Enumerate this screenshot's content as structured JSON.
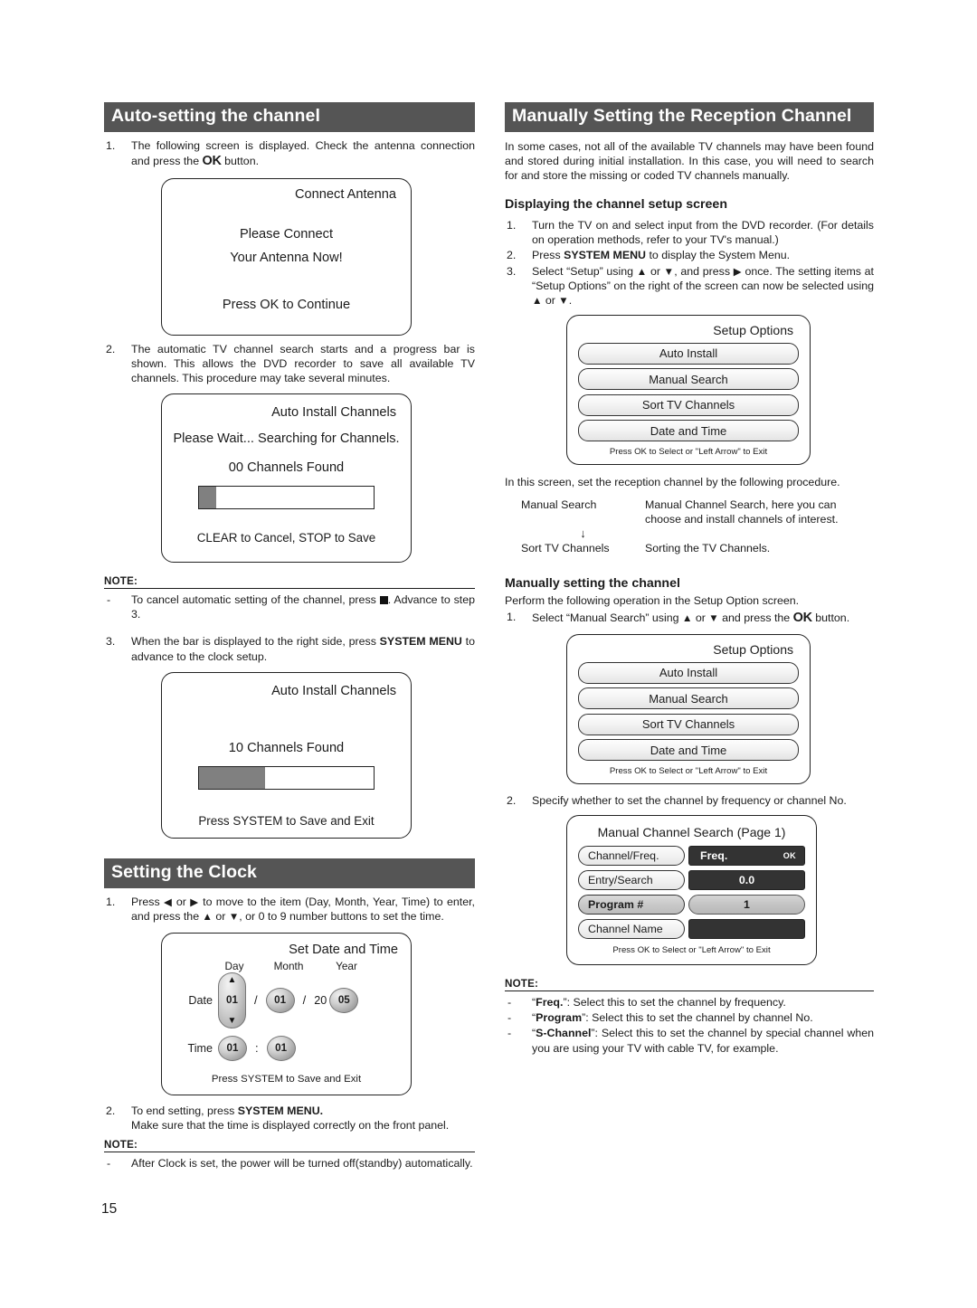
{
  "page_number": "15",
  "left_column": {
    "section1": {
      "header": "Auto-setting the channel",
      "step1": {
        "num": "1.",
        "text_a": "The following screen is displayed. Check the antenna connection and press the ",
        "ok": "OK",
        "text_b": " button."
      },
      "antenna_screen": {
        "title": "Connect Antenna",
        "line1": "Please Connect",
        "line2": "Your Antenna Now!",
        "line3": "Press OK to Continue"
      },
      "step2": {
        "num": "2.",
        "text": "The automatic TV channel search starts and a progress bar is shown. This allows the DVD recorder to save all available TV channels. This procedure may take several minutes."
      },
      "install_screen_1": {
        "title": "Auto Install Channels",
        "line1": "Please Wait... Searching for Channels.",
        "count": "00  Channels Found",
        "progress_percent": 10,
        "footer": "CLEAR to Cancel, STOP to Save"
      },
      "note": {
        "label": "NOTE:",
        "items": [
          {
            "bullet": "-",
            "text_a": "To cancel automatic setting of the channel, press ",
            "text_b": ". Advance to step 3."
          }
        ]
      },
      "step3": {
        "num": "3.",
        "text_a": "When the bar is displayed to the right side, press ",
        "bold": "SYSTEM MENU",
        "text_b": " to advance to the clock setup."
      },
      "install_screen_2": {
        "title": "Auto Install Channels",
        "count": "10  Channels Found",
        "progress_percent": 38,
        "footer": "Press SYSTEM to Save and Exit"
      }
    },
    "section2": {
      "header": "Setting the Clock",
      "step1": {
        "num": "1.",
        "text_a": "Press ",
        "left_arrow": "◀",
        "text_b": " or ",
        "right_arrow": "▶",
        "text_c": " to move to the item (Day, Month, Year, Time) to enter, and press the ",
        "up_arrow": "▲",
        "text_d": " or ",
        "down_arrow": "▼",
        "text_e": ", or 0 to 9 number buttons to set the time."
      },
      "clock_screen": {
        "title": "Set Date and Time",
        "col_day": "Day",
        "col_month": "Month",
        "col_year": "Year",
        "label_date": "Date",
        "label_time": "Time",
        "day_value": "01",
        "month_value": "01",
        "year_prefix": "20",
        "year_value": "05",
        "hour_value": "01",
        "minute_value": "01",
        "slash": "/",
        "colon": ":",
        "footer": "Press SYSTEM to Save and Exit"
      },
      "step2": {
        "num": "2.",
        "text_a": "To end setting, press ",
        "bold": "SYSTEM MENU.",
        "text_b": "Make sure that the time is displayed correctly on the front panel."
      },
      "note": {
        "label": "NOTE:",
        "items": [
          {
            "bullet": "-",
            "text": "After Clock is set, the power will be turned off(standby) automatically."
          }
        ]
      }
    }
  },
  "right_column": {
    "header": "Manually Setting the Reception Channel",
    "intro": "In some cases, not all of the available TV channels may have been found and stored during initial installation. In this case, you will need to search for and store the missing or coded TV channels manually.",
    "sub1": {
      "heading": "Displaying the channel setup screen",
      "steps": [
        {
          "num": "1.",
          "text": "Turn the TV on and select input from the DVD recorder. (For details on operation methods, refer to your TV's manual.)"
        },
        {
          "num": "2.",
          "text_a": "Press ",
          "bold": "SYSTEM MENU",
          "text_b": " to display the System Menu."
        },
        {
          "num": "3.",
          "text_a": "Select “Setup” using ",
          "up": "▲",
          "text_b": " or ",
          "down": "▼",
          "text_c": ", and press ",
          "right": "▶",
          "text_d": " once. The setting items at “Setup Options” on the right of the screen can now be selected using ",
          "up2": "▲",
          "text_e": " or ",
          "down2": "▼",
          "text_f": "."
        }
      ]
    },
    "setup_options_1": {
      "title": "Setup Options",
      "options": [
        "Auto Install",
        "Manual Search",
        "Sort TV Channels",
        "Date and Time"
      ],
      "footer": "Press OK to Select or \"Left Arrow\" to Exit"
    },
    "procedure_intro": "In this screen, set the reception channel by the following procedure.",
    "procedure": {
      "row1_left": "Manual Search",
      "row1_right": "Manual Channel Search, here you can choose and install channels of interest.",
      "arrow": "↓",
      "row2_left": "Sort TV Channels",
      "row2_right": "Sorting the TV Channels."
    },
    "sub2": {
      "heading": "Manually setting the channel",
      "intro": "Perform the following operation in the Setup Option screen.",
      "step1": {
        "num": "1.",
        "text_a": "Select “Manual Search” using ",
        "up": "▲",
        "text_b": " or ",
        "down": "▼",
        "text_c": " and press the ",
        "ok": "OK",
        "text_d": " button."
      }
    },
    "setup_options_2": {
      "title": "Setup Options",
      "options": [
        "Auto Install",
        "Manual Search",
        "Sort TV Channels",
        "Date and Time"
      ],
      "footer": "Press OK to Select or \"Left Arrow\" to Exit"
    },
    "step2": {
      "num": "2.",
      "text": "Specify whether to set the channel by frequency or channel No."
    },
    "manual_channel_search": {
      "title": "Manual Channel Search  (Page 1)",
      "rows": [
        {
          "label": "Channel/Freq.",
          "value": "Freq.",
          "ok": "OK",
          "highlight": false,
          "value_style": "dark-left"
        },
        {
          "label": "Entry/Search",
          "value": "0.0",
          "highlight": false,
          "value_style": "dark"
        },
        {
          "label": "Program #",
          "value": "1",
          "highlight": true,
          "value_style": "pill"
        },
        {
          "label": "Channel Name",
          "value": "",
          "highlight": false,
          "value_style": "dark"
        }
      ],
      "footer": "Press OK to Select or \"Left Arrow\" to Exit"
    },
    "note": {
      "label": "NOTE:",
      "items": [
        {
          "bullet": "-",
          "q": "“",
          "bold": "Freq.",
          "q2": "”: ",
          "text": "Select this to set the channel by frequency."
        },
        {
          "bullet": "-",
          "q": "“",
          "bold": "Program",
          "q2": "”: ",
          "text": "Select this to set the channel by channel No."
        },
        {
          "bullet": "-",
          "q": "“",
          "bold": "S-Channel",
          "q2": "”: ",
          "text": "Select this to set the channel by special channel when you are using your TV with cable TV, for example."
        }
      ]
    }
  }
}
